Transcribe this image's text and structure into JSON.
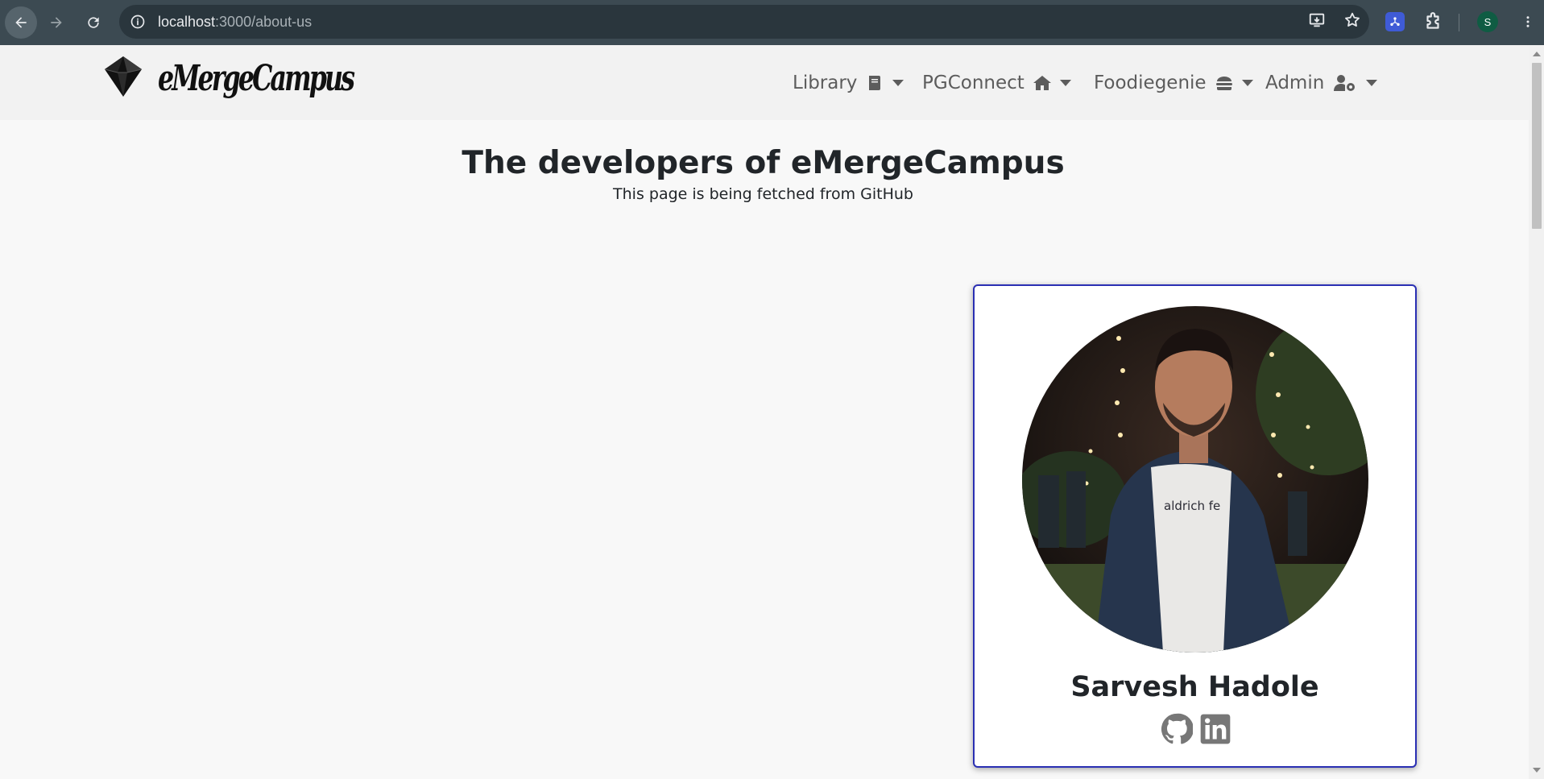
{
  "browser": {
    "url_host": "localhost",
    "url_path": ":3000/about-us",
    "profile_initial": "S"
  },
  "navbar": {
    "brand": "eMergeCampus",
    "menu": [
      {
        "label": "Library",
        "icon": "book-icon"
      },
      {
        "label": "PGConnect",
        "icon": "home-icon"
      },
      {
        "label": "Foodiegenie",
        "icon": "burger-icon"
      },
      {
        "label": "Admin",
        "icon": "user-gear-icon"
      }
    ]
  },
  "main": {
    "title": "The developers of eMergeCampus",
    "subtitle": "This page is being fetched from GitHub"
  },
  "developer": {
    "name": "Sarvesh Hadole",
    "photo_shirt_text": "aldrich fe",
    "links": [
      "github-icon",
      "linkedin-icon"
    ]
  },
  "colors": {
    "card_border": "#2a2fb3",
    "chrome": "#3c4a52",
    "text": "#212529"
  }
}
